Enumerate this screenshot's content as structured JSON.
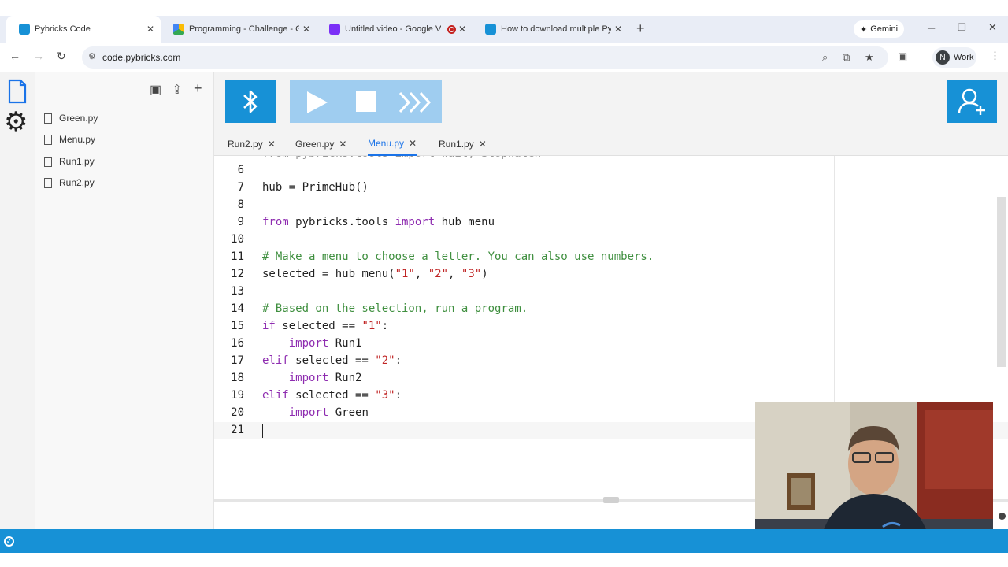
{
  "browser": {
    "tabs": [
      {
        "title": "Pybricks Code",
        "active": true,
        "favicon_color": "#1791d6"
      },
      {
        "title": "Programming - Challenge - Go",
        "active": false,
        "favicon_color": "#34a853"
      },
      {
        "title": "Untitled video - Google Vid",
        "active": false,
        "favicon_color": "#7b2ff7",
        "recording": true
      },
      {
        "title": "How to download multiple Pyb",
        "active": false,
        "favicon_color": "#1791d6"
      }
    ],
    "new_tab": "+",
    "gemini_label": "Gemini",
    "url": "code.pybricks.com",
    "profile_initial": "N",
    "profile_label": "Work"
  },
  "explorer": {
    "files": [
      "Green.py",
      "Menu.py",
      "Run1.py",
      "Run2.py"
    ]
  },
  "editor": {
    "tabs": [
      {
        "label": "Run2.py",
        "active": false
      },
      {
        "label": "Green.py",
        "active": false
      },
      {
        "label": "Menu.py",
        "active": true
      },
      {
        "label": "Run1.py",
        "active": false
      }
    ],
    "lines": [
      {
        "n": "6",
        "html": ""
      },
      {
        "n": "7",
        "html": "hub = PrimeHub()"
      },
      {
        "n": "8",
        "html": ""
      },
      {
        "n": "9",
        "html": "<span class=\"kw\">from</span> pybricks.tools <span class=\"kw\">import</span> hub_menu"
      },
      {
        "n": "10",
        "html": ""
      },
      {
        "n": "11",
        "html": "<span class=\"cm\"># Make a menu to choose a letter. You can also use numbers.</span>"
      },
      {
        "n": "12",
        "html": "selected = hub_menu(<span class=\"st\">\"1\"</span>, <span class=\"st\">\"2\"</span>, <span class=\"st\">\"3\"</span>)"
      },
      {
        "n": "13",
        "html": ""
      },
      {
        "n": "14",
        "html": "<span class=\"cm\"># Based on the selection, run a program.</span>"
      },
      {
        "n": "15",
        "html": "<span class=\"kw\">if</span> selected == <span class=\"st\">\"1\"</span>:"
      },
      {
        "n": "16",
        "html": "    <span class=\"kw\">import</span> Run1"
      },
      {
        "n": "17",
        "html": "<span class=\"kw\">elif</span> selected == <span class=\"st\">\"2\"</span>:"
      },
      {
        "n": "18",
        "html": "    <span class=\"kw\">import</span> Run2"
      },
      {
        "n": "19",
        "html": "<span class=\"kw\">elif</span> selected == <span class=\"st\">\"3\"</span>:"
      },
      {
        "n": "20",
        "html": "    <span class=\"kw\">import</span> Green"
      },
      {
        "n": "21",
        "html": ""
      }
    ]
  },
  "colors": {
    "accent": "#1791d6",
    "run_disabled": "#9fcdf0",
    "keyword": "#8e2cb0",
    "comment": "#3f8f3f",
    "string": "#c02525"
  }
}
